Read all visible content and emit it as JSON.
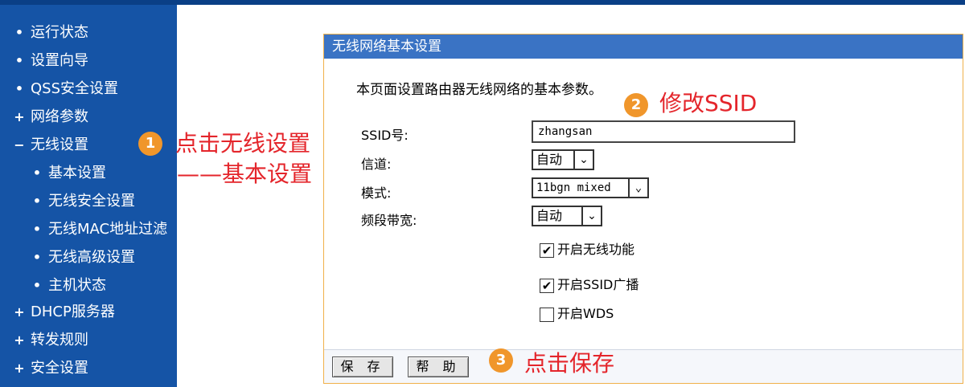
{
  "sidebar": {
    "items": [
      {
        "mark": "•",
        "label": "运行状态"
      },
      {
        "mark": "•",
        "label": "设置向导"
      },
      {
        "mark": "•",
        "label": "QSS安全设置"
      },
      {
        "mark": "+",
        "label": "网络参数"
      },
      {
        "mark": "−",
        "label": "无线设置"
      },
      {
        "mark": "•",
        "label": "基本设置"
      },
      {
        "mark": "•",
        "label": "无线安全设置"
      },
      {
        "mark": "•",
        "label": "无线MAC地址过滤"
      },
      {
        "mark": "•",
        "label": "无线高级设置"
      },
      {
        "mark": "•",
        "label": "主机状态"
      },
      {
        "mark": "+",
        "label": "DHCP服务器"
      },
      {
        "mark": "+",
        "label": "转发规则"
      },
      {
        "mark": "+",
        "label": "安全设置"
      }
    ]
  },
  "panel": {
    "title": "无线网络基本设置",
    "description": "本页面设置路由器无线网络的基本参数。",
    "fields": {
      "ssid_label": "SSID号:",
      "ssid_value": "zhangsan",
      "channel_label": "信道:",
      "channel_value": "自动",
      "mode_label": "模式:",
      "mode_value": "11bgn mixed",
      "width_label": "频段带宽:",
      "width_value": "自动"
    },
    "checks": [
      {
        "label": "开启无线功能",
        "checked": true
      },
      {
        "label": "开启SSID广播",
        "checked": true
      },
      {
        "label": "开启WDS",
        "checked": false
      }
    ],
    "buttons": {
      "save": "保 存",
      "help": "帮 助"
    }
  },
  "annotations": {
    "step1_num": "1",
    "step1_line1": "点击无线设置",
    "step1_line2": "——基本设置",
    "step2_num": "2",
    "step2_text": "修改SSID",
    "step3_num": "3",
    "step3_text": "点击保存"
  },
  "colors": {
    "sidebar_bg": "#1554a6",
    "panel_header": "#3a73c4",
    "panel_border": "#f0b04a",
    "annotation_red": "#e4252b",
    "badge_orange": "#f0962b"
  },
  "icons": {
    "dropdown": "chevron-down-icon",
    "checkbox_checked": "check-icon"
  }
}
